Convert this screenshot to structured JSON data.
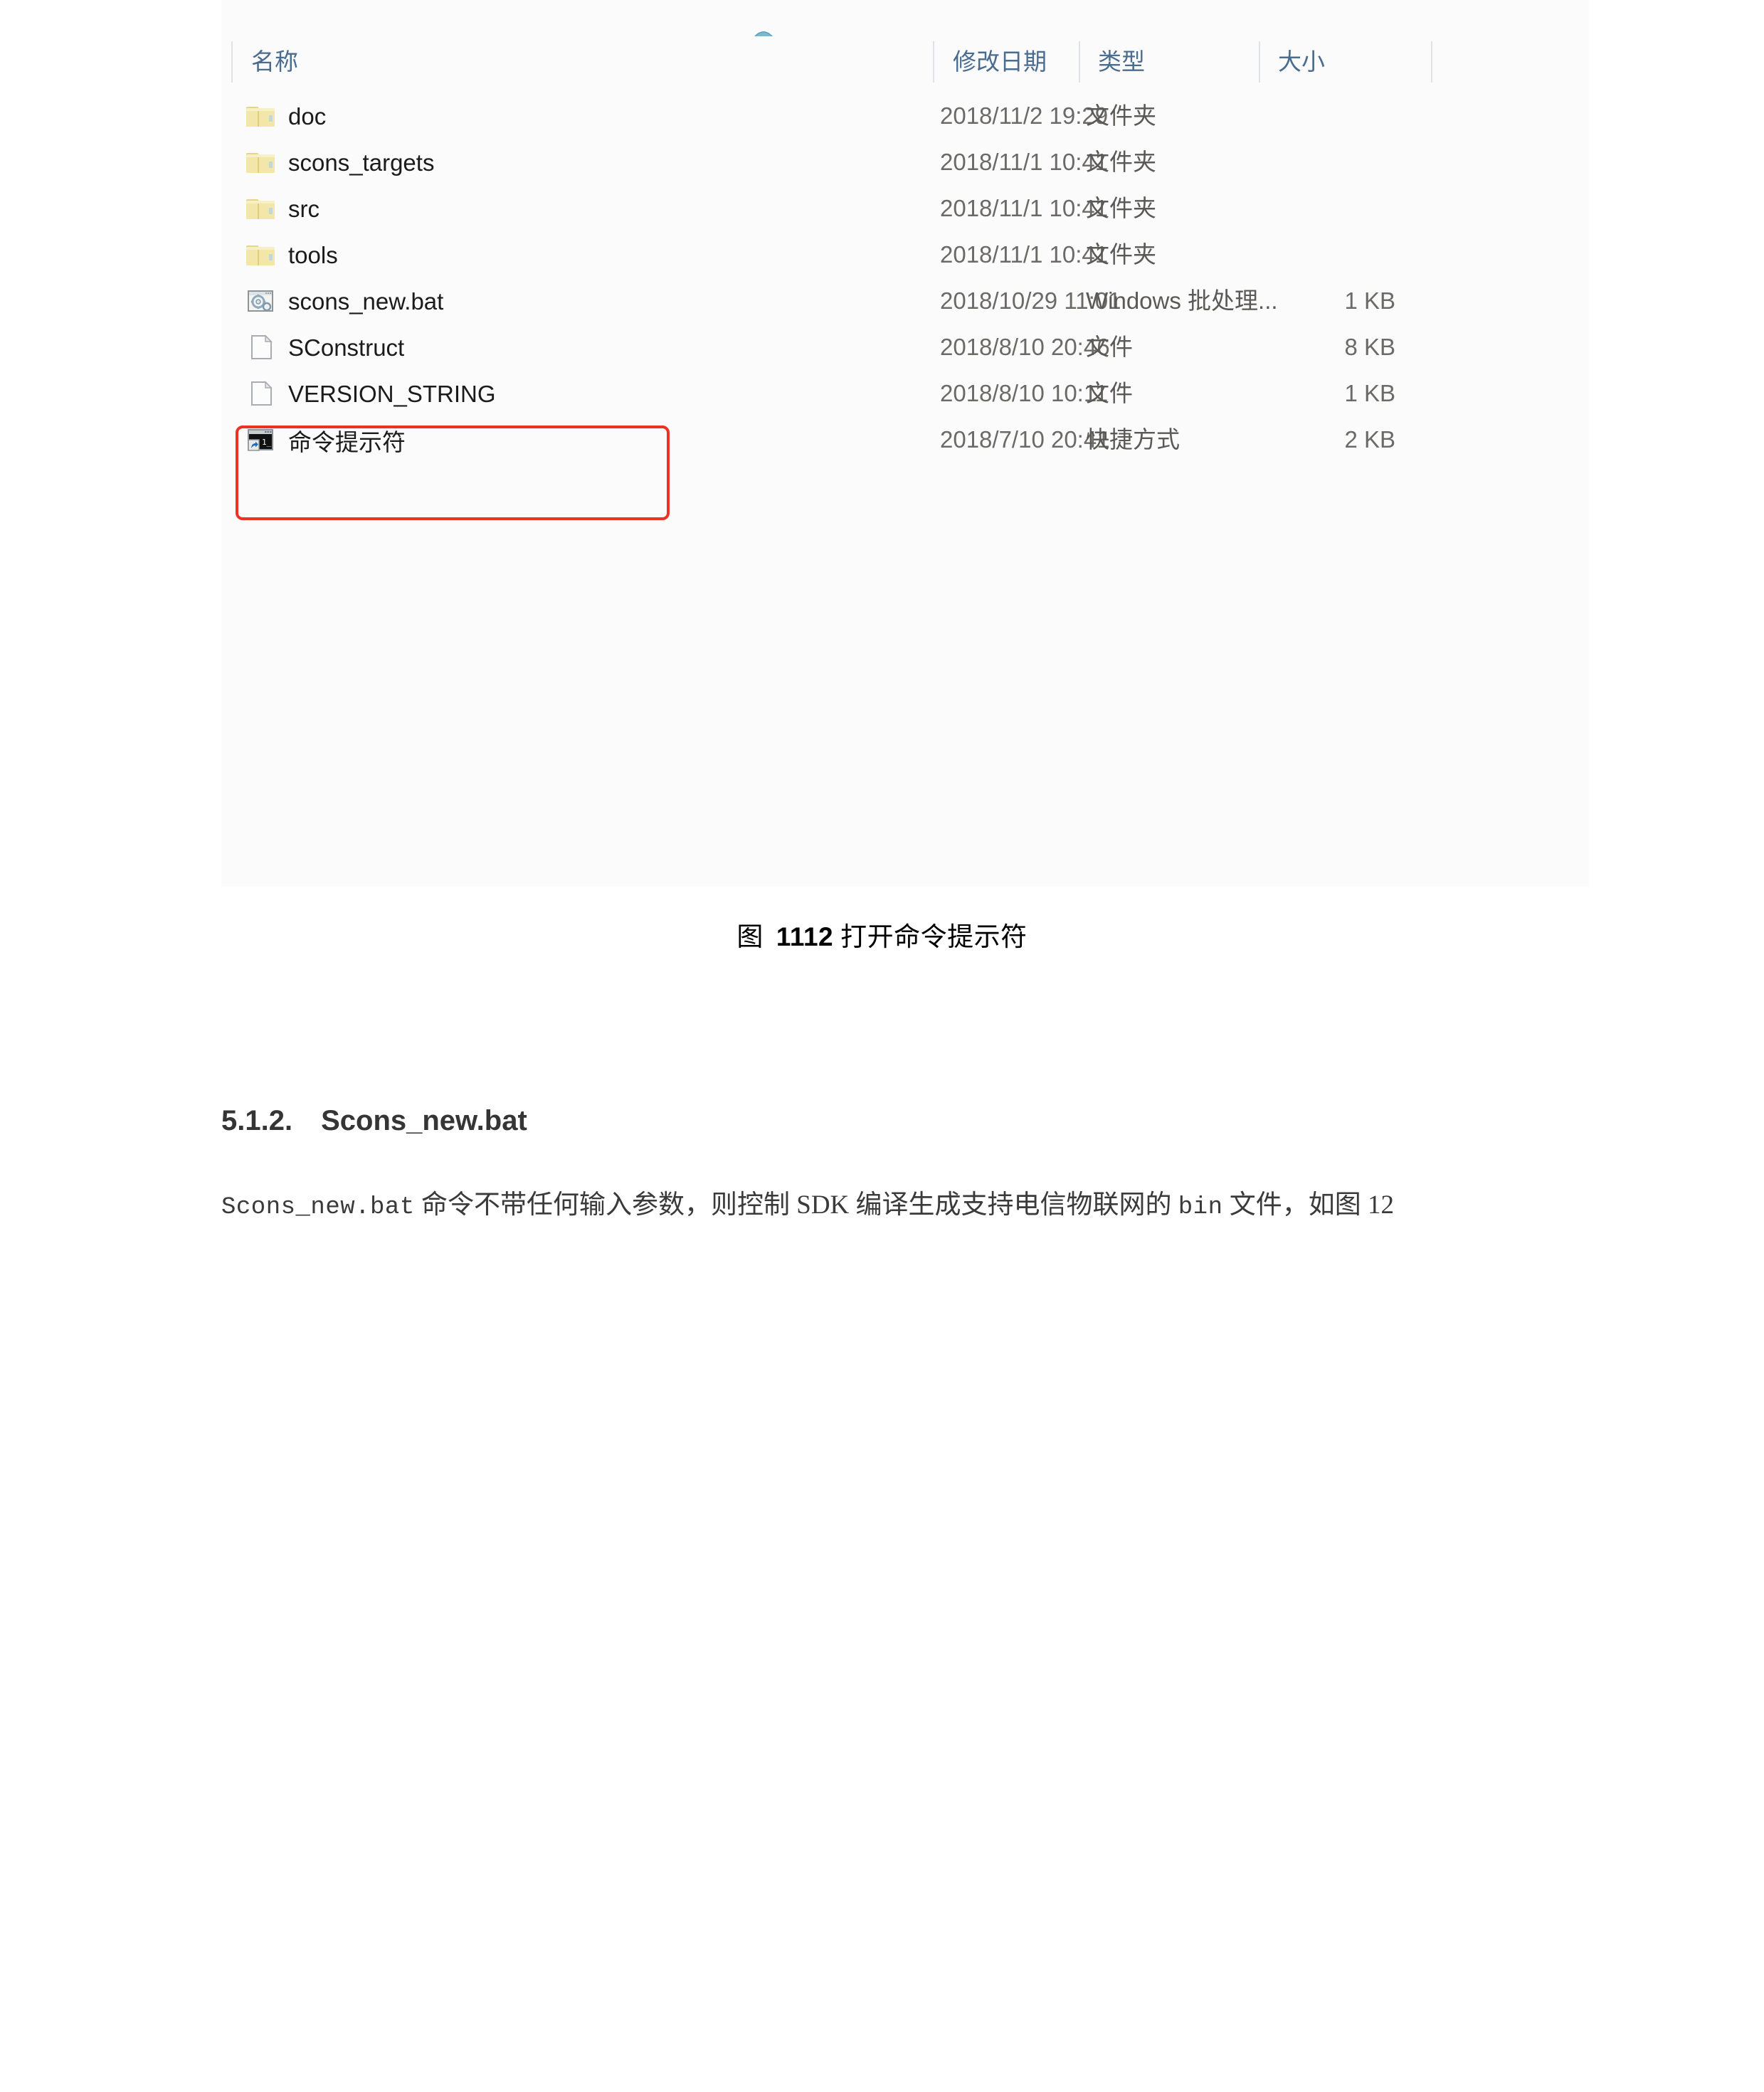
{
  "explorer": {
    "columns": [
      {
        "key": "name",
        "label": "名称"
      },
      {
        "key": "date",
        "label": "修改日期"
      },
      {
        "key": "type",
        "label": "类型"
      },
      {
        "key": "size",
        "label": "大小"
      }
    ],
    "sort": {
      "column": "名称",
      "direction": "ascending",
      "icon": "sort-ascending-icon"
    },
    "rows": [
      {
        "name": "doc",
        "icon": "folder-icon",
        "date": "2018/11/2 19:29",
        "type": "文件夹",
        "size": ""
      },
      {
        "name": "scons_targets",
        "icon": "folder-icon",
        "date": "2018/11/1 10:41",
        "type": "文件夹",
        "size": ""
      },
      {
        "name": "src",
        "icon": "folder-icon",
        "date": "2018/11/1 10:41",
        "type": "文件夹",
        "size": ""
      },
      {
        "name": "tools",
        "icon": "folder-icon",
        "date": "2018/11/1 10:41",
        "type": "文件夹",
        "size": ""
      },
      {
        "name": "scons_new.bat",
        "icon": "batch-file-icon",
        "date": "2018/10/29 11:01",
        "type": "Windows 批处理...",
        "size": "1 KB"
      },
      {
        "name": "SConstruct",
        "icon": "generic-file-icon",
        "date": "2018/8/10 20:46",
        "type": "文件",
        "size": "8 KB"
      },
      {
        "name": "VERSION_STRING",
        "icon": "generic-file-icon",
        "date": "2018/8/10 10:11",
        "type": "文件",
        "size": "1 KB"
      },
      {
        "name": "命令提示符",
        "icon": "command-prompt-icon",
        "date": "2018/7/10 20:41",
        "type": "快捷方式",
        "size": "2 KB"
      }
    ],
    "highlight": {
      "target_row": "命令提示符",
      "color": "#ef3124"
    }
  },
  "figure": {
    "prefix": "图",
    "number": "1112",
    "title": "打开命令提示符"
  },
  "section": {
    "number": "5.1.2.",
    "title": "Scons_new.bat"
  },
  "paragraph": {
    "code1": "Scons_new.bat",
    "text1": " 命令不带任何输入参数，则控制 SDK 编译生成支持电信物联网的 ",
    "code2": "bin",
    "text2": " 文件，如图 12"
  },
  "colors": {
    "panel_bg": "#fbfbfc",
    "header_text": "#4a6c8f",
    "row_text": "#1b1b1b",
    "meta_text": "#6c6a67",
    "highlight": "#ef3124"
  }
}
